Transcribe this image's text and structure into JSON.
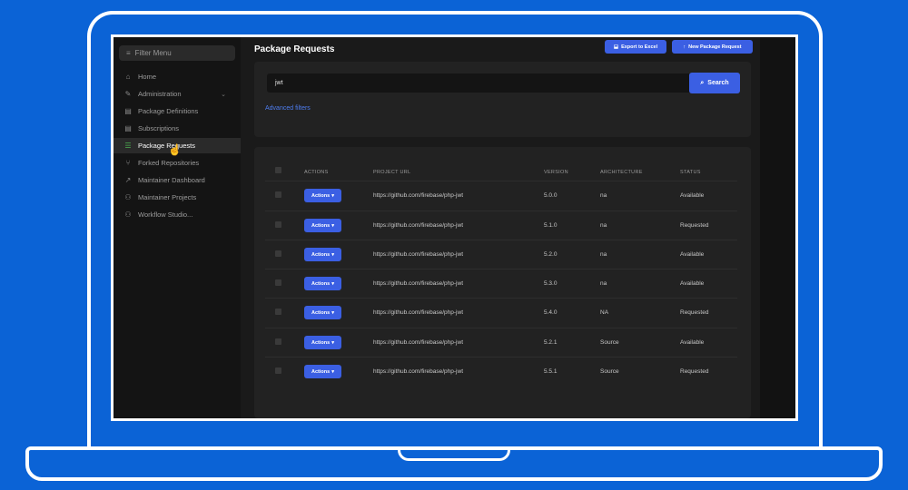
{
  "sidebar": {
    "filter_placeholder": "Filter Menu",
    "items": [
      {
        "label": "Home",
        "icon": "home-icon",
        "glyph": "⌂"
      },
      {
        "label": "Administration",
        "icon": "wrench-icon",
        "glyph": "✎"
      },
      {
        "label": "Package Definitions",
        "icon": "document-icon",
        "glyph": "▤"
      },
      {
        "label": "Subscriptions",
        "icon": "document-icon",
        "glyph": "▤"
      },
      {
        "label": "Package Requests",
        "icon": "list-check-icon",
        "glyph": "☰"
      },
      {
        "label": "Forked Repositories",
        "icon": "branch-icon",
        "glyph": "⑂"
      },
      {
        "label": "Maintainer Dashboard",
        "icon": "chart-icon",
        "glyph": "↗"
      },
      {
        "label": "Maintainer Projects",
        "icon": "network-icon",
        "glyph": "⚇"
      },
      {
        "label": "Workflow Studio...",
        "icon": "workflow-icon",
        "glyph": "⚇"
      }
    ]
  },
  "header": {
    "title": "Package Requests",
    "export_label": "Export to Excel",
    "new_label": "New Package Request"
  },
  "search": {
    "value": "jwt",
    "button_label": "Search",
    "advanced_filters": "Advanced filters"
  },
  "table": {
    "columns": [
      "ACTIONS",
      "PROJECT URL",
      "VERSION",
      "ARCHITECTURE",
      "STATUS"
    ],
    "action_label": "Actions",
    "rows": [
      {
        "url": "https://github.com/firebase/php-jwt",
        "version": "5.0.0",
        "arch": "na",
        "status": "Available"
      },
      {
        "url": "https://github.com/firebase/php-jwt",
        "version": "5.1.0",
        "arch": "na",
        "status": "Requested"
      },
      {
        "url": "https://github.com/firebase/php-jwt",
        "version": "5.2.0",
        "arch": "na",
        "status": "Available"
      },
      {
        "url": "https://github.com/firebase/php-jwt",
        "version": "5.3.0",
        "arch": "na",
        "status": "Available"
      },
      {
        "url": "https://github.com/firebase/php-jwt",
        "version": "5.4.0",
        "arch": "NA",
        "status": "Requested"
      },
      {
        "url": "https://github.com/firebase/php-jwt",
        "version": "5.2.1",
        "arch": "Source",
        "status": "Available"
      },
      {
        "url": "https://github.com/firebase/php-jwt",
        "version": "5.5.1",
        "arch": "Source",
        "status": "Requested"
      }
    ]
  },
  "colors": {
    "background": "#0b63d6",
    "accent": "#3b5fe3",
    "link": "#4e7df0"
  }
}
